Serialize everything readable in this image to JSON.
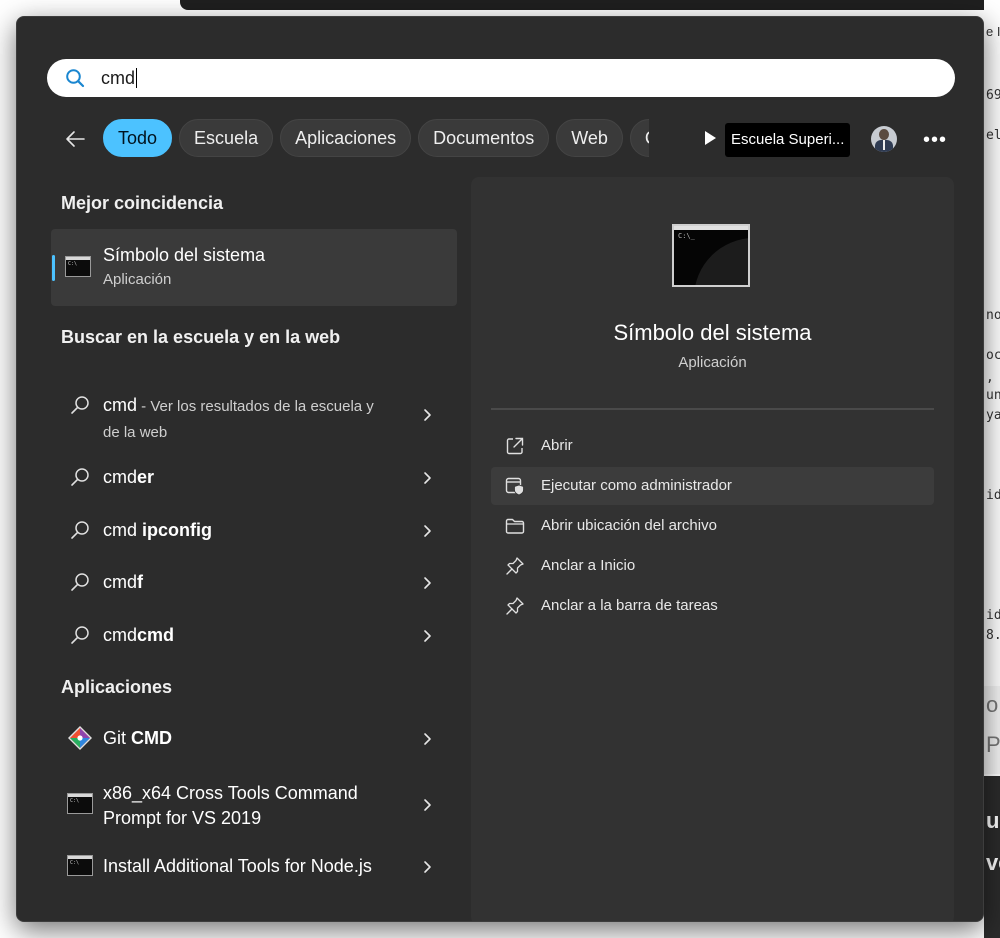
{
  "background": {
    "fragments_mono": [
      "e In",
      "69",
      "el",
      "no",
      "oc",
      ",",
      "un",
      "ya",
      "id",
      "id",
      "8."
    ],
    "fragments_big": [
      "o",
      "Pa"
    ],
    "fragments_big_white": [
      "ue",
      "ve"
    ]
  },
  "search": {
    "value": "cmd",
    "icon": "search-icon"
  },
  "filters": {
    "back_icon": "back-arrow-icon",
    "chips": [
      {
        "label": "Todo",
        "active": true
      },
      {
        "label": "Escuela",
        "active": false
      },
      {
        "label": "Aplicaciones",
        "active": false
      },
      {
        "label": "Documentos",
        "active": false
      },
      {
        "label": "Web",
        "active": false
      },
      {
        "label": "Con",
        "active": false
      }
    ],
    "org_label": "Escuela Superi...",
    "more_label": "•••"
  },
  "left": {
    "best_match_title": "Mejor coincidencia",
    "best_match": {
      "title": "Símbolo del sistema",
      "subtitle": "Aplicación"
    },
    "web_title": "Buscar en la escuela y en la web",
    "web_results": [
      {
        "prefix": "cmd",
        "bold": "",
        "desc_line1": " - Ver los resultados de la escuela y",
        "desc_line2": "de la web"
      },
      {
        "prefix": "cmd",
        "bold": "er"
      },
      {
        "prefix": "cmd ",
        "bold": "ipconfig"
      },
      {
        "prefix": "cmd",
        "bold": "f"
      },
      {
        "prefix": "cmd",
        "bold": "cmd"
      }
    ],
    "apps_title": "Aplicaciones",
    "apps": [
      {
        "prefix": "Git ",
        "bold": "CMD",
        "icon": "git-icon"
      },
      {
        "line1": "x86_x64 Cross Tools Command",
        "line2": "Prompt for VS 2019",
        "icon": "console-icon"
      },
      {
        "label": "Install Additional Tools for Node.js",
        "icon": "console-icon"
      }
    ]
  },
  "detail": {
    "title": "Símbolo del sistema",
    "subtitle": "Aplicación",
    "actions": [
      {
        "label": "Abrir",
        "icon": "open-external-icon"
      },
      {
        "label": "Ejecutar como administrador",
        "icon": "shield-admin-icon"
      },
      {
        "label": "Abrir ubicación del archivo",
        "icon": "folder-icon"
      },
      {
        "label": "Anclar a Inicio",
        "icon": "pin-icon"
      },
      {
        "label": "Anclar a la barra de tareas",
        "icon": "pin-icon"
      }
    ]
  },
  "colors": {
    "accent": "#4cc2ff",
    "panel": "#2c2c2c",
    "detail_panel": "#323232"
  }
}
